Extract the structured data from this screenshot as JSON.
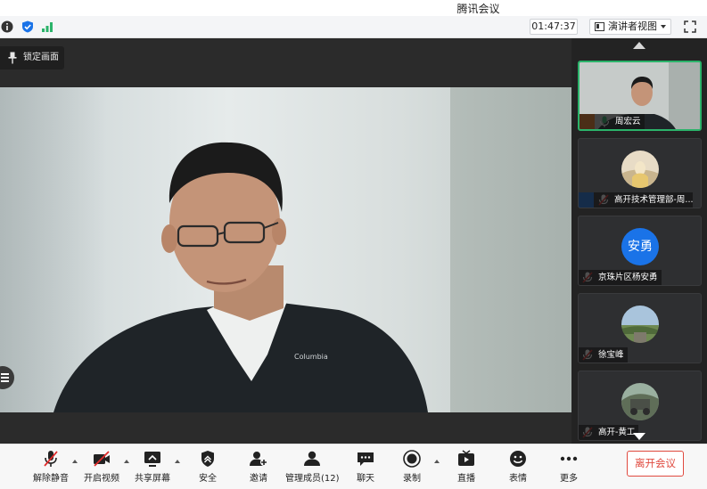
{
  "window": {
    "title": "腾讯会议"
  },
  "status": {
    "timer": "01:47:37",
    "view_label": "演讲者视图"
  },
  "stage": {
    "lock_label": "锁定画面",
    "speaker_jacket_brand": "Columbia"
  },
  "participants": [
    {
      "name": "周宏云",
      "type": "video",
      "active": true,
      "role_color": "#ef7d22"
    },
    {
      "name": "高开技术管理部-周...",
      "type": "avatar-image",
      "role_color": "#1a73e8"
    },
    {
      "name": "京珠片区杨安勇",
      "type": "avatar-text",
      "avatar_text": "安勇"
    },
    {
      "name": "徐宝峰",
      "type": "avatar-image"
    },
    {
      "name": "高开-黄工",
      "type": "avatar-image"
    }
  ],
  "toolbar": {
    "unmute": "解除静音",
    "start_video": "开启视频",
    "share_screen": "共享屏幕",
    "security": "安全",
    "invite": "邀请",
    "manage_members": "管理成员(12)",
    "chat": "聊天",
    "record": "录制",
    "live": "直播",
    "reactions": "表情",
    "more": "更多",
    "leave": "离开会议"
  },
  "colors": {
    "accent": "#1a73e8",
    "active_border": "#2bb36a",
    "leave_red": "#e04a3f",
    "mute_red": "#e02b2b"
  }
}
